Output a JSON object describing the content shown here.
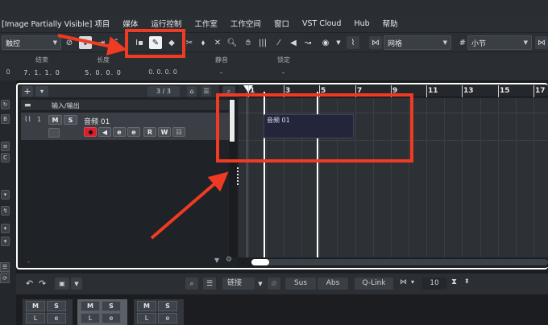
{
  "menu": {
    "items": [
      "[Image Partially Visible] 项目",
      "媒体",
      "运行控制",
      "工作室",
      "工作空间",
      "窗口",
      "VST Cloud",
      "Hub",
      "帮助"
    ]
  },
  "toolbar": {
    "touch_mode": "触控",
    "snap_type": "网格",
    "grid_type": "小节",
    "tools": [
      "range-tool-icon",
      "draw-tool-icon",
      "erase-tool-icon",
      "split-tool-icon",
      "glue-tool-icon",
      "delete-tool-icon",
      "zoom-tool-icon",
      "mute-tool-icon",
      "line-tool-icon",
      "play-tool-icon",
      "warp-tool-icon"
    ]
  },
  "info_line": {
    "left_value": "0",
    "end_label": "结束",
    "end_value": "7. 1. 1.   0",
    "length_label": "长度",
    "length_value": "5. 0. 0.   0",
    "offset_value": "0. 0. 0.   0",
    "mute_label": "静音",
    "mute_value": "-",
    "lock_label": "锁定",
    "lock_value": "-"
  },
  "track_list": {
    "count": "3 / 3",
    "tracks": [
      {
        "name": "输入/输出",
        "type": "folder"
      },
      {
        "number": "1",
        "name": "音频 01",
        "type": "audio",
        "mute": "M",
        "solo": "S",
        "read": "R",
        "write": "W"
      }
    ]
  },
  "ruler": {
    "labels": [
      "1",
      "3",
      "5",
      "7",
      "9",
      "11",
      "13",
      "15",
      "17"
    ]
  },
  "clip": {
    "name": "音频 01"
  },
  "lower_zone": {
    "link_label": "链接",
    "sus_label": "Sus",
    "abs_label": "Abs",
    "qlink_label": "Q-Link",
    "zoom_value": "10"
  },
  "mixer": {
    "channels": [
      {
        "mute": "M",
        "solo": "S",
        "listen": "L",
        "edit": "e"
      },
      {
        "mute": "M",
        "solo": "S",
        "listen": "L",
        "edit": "e"
      },
      {
        "mute": "M",
        "solo": "S",
        "listen": "L",
        "edit": "e"
      }
    ]
  },
  "colors": {
    "annotation_red": "#ef3b24",
    "record_red": "#d8202a",
    "clip_fill": "#23263a",
    "background": "#1b1d20"
  }
}
